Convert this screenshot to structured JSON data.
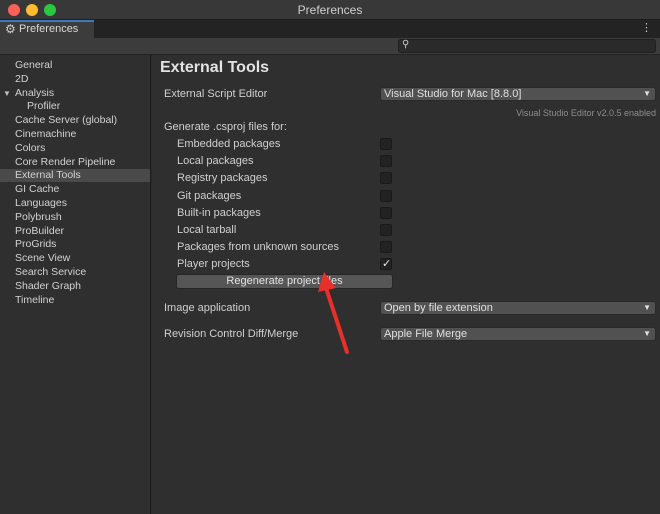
{
  "window": {
    "title": "Preferences"
  },
  "tab": {
    "label": "Preferences",
    "icon": "gear-icon"
  },
  "search": {
    "value": "",
    "placeholder": ""
  },
  "sidebar": {
    "items": [
      {
        "label": "General"
      },
      {
        "label": "2D"
      },
      {
        "label": "Analysis"
      },
      {
        "label": "Profiler"
      },
      {
        "label": "Cache Server (global)"
      },
      {
        "label": "Cinemachine"
      },
      {
        "label": "Colors"
      },
      {
        "label": "Core Render Pipeline"
      },
      {
        "label": "External Tools"
      },
      {
        "label": "GI Cache"
      },
      {
        "label": "Languages"
      },
      {
        "label": "Polybrush"
      },
      {
        "label": "ProBuilder"
      },
      {
        "label": "ProGrids"
      },
      {
        "label": "Scene View"
      },
      {
        "label": "Search Service"
      },
      {
        "label": "Shader Graph"
      },
      {
        "label": "Timeline"
      }
    ],
    "selected": "External Tools"
  },
  "main": {
    "title": "External Tools",
    "script_editor_label": "External Script Editor",
    "script_editor_value": "Visual Studio for Mac [8.8.0]",
    "editor_version_hint": "Visual Studio Editor v2.0.5 enabled",
    "generate_label": "Generate .csproj files for:",
    "csproj_options": [
      {
        "label": "Embedded packages",
        "checked": false
      },
      {
        "label": "Local packages",
        "checked": false
      },
      {
        "label": "Registry packages",
        "checked": false
      },
      {
        "label": "Git packages",
        "checked": false
      },
      {
        "label": "Built-in packages",
        "checked": false
      },
      {
        "label": "Local tarball",
        "checked": false
      },
      {
        "label": "Packages from unknown sources",
        "checked": false
      },
      {
        "label": "Player projects",
        "checked": true
      }
    ],
    "check_mark": "✓",
    "regenerate_label": "Regenerate project files",
    "image_app_label": "Image application",
    "image_app_value": "Open by file extension",
    "diff_label": "Revision Control Diff/Merge",
    "diff_value": "Apple File Merge"
  },
  "colors": {
    "arrow": "#e8302a",
    "accent": "#3a79bb"
  }
}
